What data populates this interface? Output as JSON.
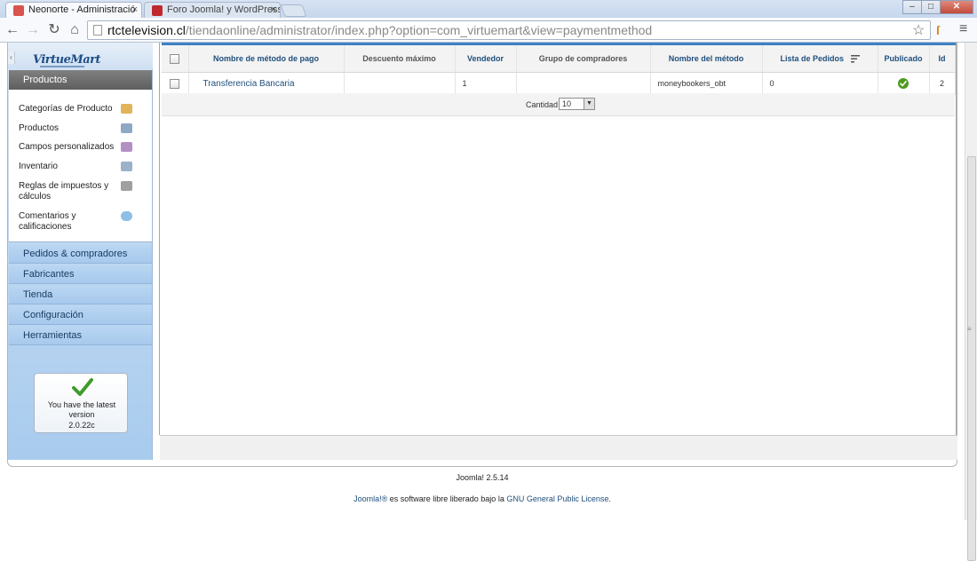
{
  "browser": {
    "tabs": [
      {
        "title": "Neonorte - Administració",
        "active": true,
        "favicon_color": "#d9534f"
      },
      {
        "title": "Foro Joomla! y WordPress",
        "active": false,
        "favicon_color": "#c0282d"
      }
    ],
    "tab_close_glyph": "×",
    "url_host": "rtctelevision.cl",
    "url_path": "/tiendaonline/administrator/index.php?option=com_virtuemart&view=paymentmethod",
    "window_minimize": "–",
    "window_maximize": "□",
    "window_close": "✕"
  },
  "sidebar": {
    "logo_text": "VirtueMart",
    "active_section": "Productos",
    "sub_items": [
      {
        "label": "Categorías de Producto",
        "icon": "folder-icon",
        "color": "#e2b45c"
      },
      {
        "label": "Productos",
        "icon": "product-icon",
        "color": "#8fa8c4"
      },
      {
        "label": "Campos personalizados",
        "icon": "custom-fields-icon",
        "color": "#b48fc4"
      },
      {
        "label": "Inventario",
        "icon": "inventory-icon",
        "color": "#9bb1c9"
      },
      {
        "label": "Reglas de impuestos y",
        "label2": "cálculos",
        "icon": "calculator-icon",
        "color": "#a0a0a0"
      },
      {
        "label": "Comentarios y",
        "label2": "calificaciones",
        "icon": "comment-icon",
        "color": "#8ec0e6"
      }
    ],
    "sections": [
      "Pedidos & compradores",
      "Fabricantes",
      "Tienda",
      "Configuración",
      "Herramientas"
    ],
    "version_text": "You have the latest version",
    "version_number": "2.0.22c"
  },
  "table": {
    "headers": [
      "Nombre de método de pago",
      "Descuento máximo",
      "Vendedor",
      "Grupo de compradores",
      "Nombre del método",
      "Lista de Pedidos",
      "Publicado",
      "Id"
    ],
    "rows": [
      {
        "name": "Transferencia Bancaria",
        "discount": "",
        "vendor": "1",
        "group": "",
        "method": "moneybookers_obt",
        "order": "0",
        "published": true,
        "id": "2"
      }
    ],
    "pagination_label": "Cantidad",
    "pagination_value": "10"
  },
  "footer": {
    "version": "Joomla! 2.5.14",
    "license_prefix": "Joomla!®",
    "license_middle": " es software libre liberado bajo la ",
    "license_link": "GNU General Public License",
    "license_suffix": "."
  }
}
